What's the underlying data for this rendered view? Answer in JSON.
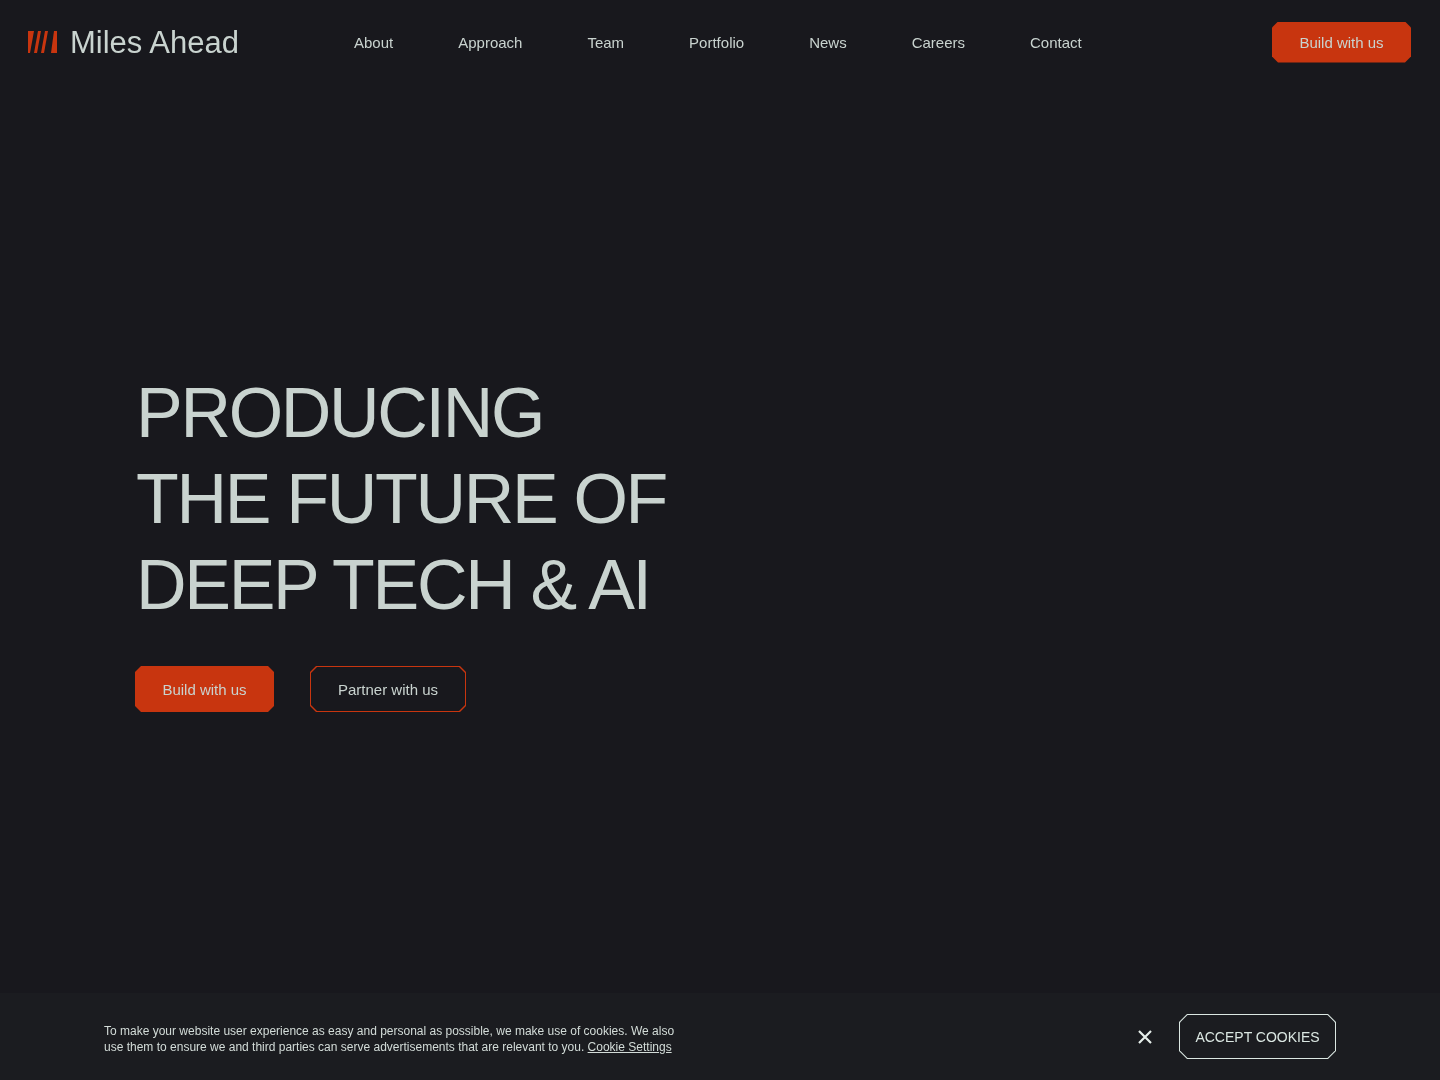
{
  "header": {
    "logo": "Miles Ahead",
    "nav": [
      {
        "label": "About"
      },
      {
        "label": "Approach"
      },
      {
        "label": "Team"
      },
      {
        "label": "Portfolio"
      },
      {
        "label": "News"
      },
      {
        "label": "Careers"
      },
      {
        "label": "Contact"
      }
    ],
    "cta": "Build with us"
  },
  "hero": {
    "headline_lines": [
      "PRODUCING",
      "THE FUTURE OF",
      "DEEP TECH & AI"
    ],
    "buttons": [
      {
        "label": "Build with us",
        "kind": "primary"
      },
      {
        "label": "Partner with us",
        "kind": "outline"
      }
    ]
  },
  "cookie_banner": {
    "text": "To make your website user experience as easy and personal as possible, we make use of cookies. We also use them to ensure we and third parties can serve advertisements that are relevant to you.",
    "link": "Cookie Settings",
    "accept": "ACCEPT COOKIES"
  }
}
